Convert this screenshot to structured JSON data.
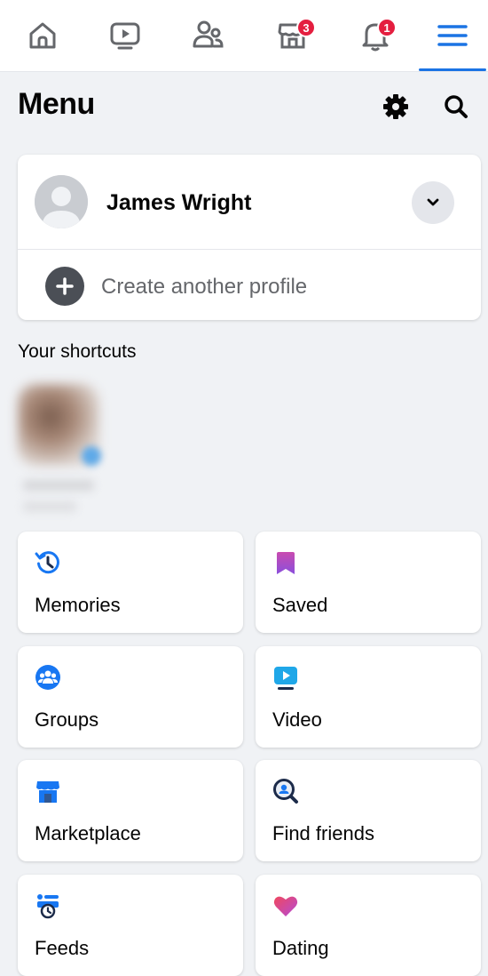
{
  "nav": {
    "tabs": [
      {
        "name": "home",
        "icon": "home-icon"
      },
      {
        "name": "watch",
        "icon": "video-icon"
      },
      {
        "name": "friends",
        "icon": "friends-icon"
      },
      {
        "name": "marketplace",
        "icon": "marketplace-icon",
        "badge": "3"
      },
      {
        "name": "notifications",
        "icon": "bell-icon",
        "badge": "1"
      },
      {
        "name": "menu",
        "icon": "hamburger-icon",
        "active": true
      }
    ],
    "marketplace_badge": "3",
    "notifications_badge": "1"
  },
  "header": {
    "title": "Menu"
  },
  "profile": {
    "name": "James Wright",
    "create_label": "Create another profile"
  },
  "shortcuts": {
    "label": "Your shortcuts"
  },
  "tiles": {
    "memories": "Memories",
    "saved": "Saved",
    "groups": "Groups",
    "video": "Video",
    "marketplace": "Marketplace",
    "find_friends": "Find friends",
    "feeds": "Feeds",
    "dating": "Dating"
  },
  "colors": {
    "accent": "#1b74e4",
    "badge": "#e41e3f",
    "background": "#f0f2f5"
  }
}
